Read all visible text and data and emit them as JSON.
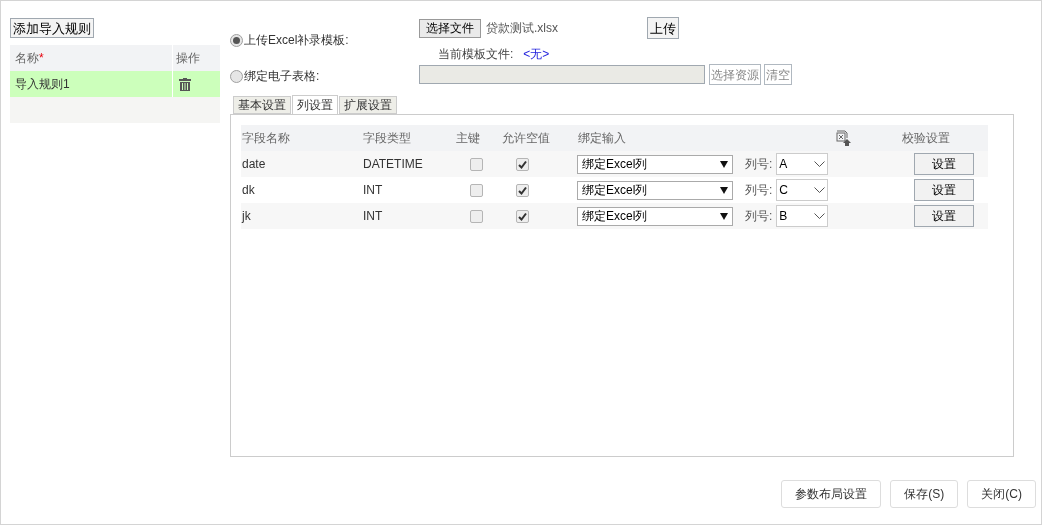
{
  "add_rule_button": "添加导入规则",
  "rules_table": {
    "columns": [
      "名称",
      "操作"
    ],
    "required_mark": "*",
    "rows": [
      {
        "name": "导入规则1",
        "selected": true
      }
    ]
  },
  "source_options": [
    {
      "label": "上传Excel补录模板:",
      "selected": true
    },
    {
      "label": "绑定电子表格:",
      "selected": false
    }
  ],
  "file_picker": {
    "button": "选择文件",
    "file_name": "贷款测试.xlsx",
    "upload_button": "上传"
  },
  "current_template": {
    "label": "当前模板文件:",
    "value": "<无>"
  },
  "sheet_binding": {
    "select_resource_button": "选择资源",
    "clear_button": "清空"
  },
  "tabs": [
    {
      "label": "基本设置",
      "selected": false
    },
    {
      "label": "列设置",
      "selected": true
    },
    {
      "label": "扩展设置",
      "selected": false
    }
  ],
  "columns_table": {
    "headers": [
      "字段名称",
      "字段类型",
      "主键",
      "允许空值",
      "绑定输入",
      "校验设置"
    ],
    "rows": [
      {
        "field": "date",
        "type": "DATETIME",
        "primary_key": false,
        "nullable": true,
        "binding": "绑定Excel列",
        "column_label": "列号:",
        "column": "A",
        "validate_button": "设置"
      },
      {
        "field": "dk",
        "type": "INT",
        "primary_key": false,
        "nullable": true,
        "binding": "绑定Excel列",
        "column_label": "列号:",
        "column": "C",
        "validate_button": "设置"
      },
      {
        "field": "jk",
        "type": "INT",
        "primary_key": false,
        "nullable": true,
        "binding": "绑定Excel列",
        "column_label": "列号:",
        "column": "B",
        "validate_button": "设置"
      }
    ]
  },
  "footer_buttons": [
    "参数布局设置",
    "保存(S)",
    "关闭(C)"
  ]
}
